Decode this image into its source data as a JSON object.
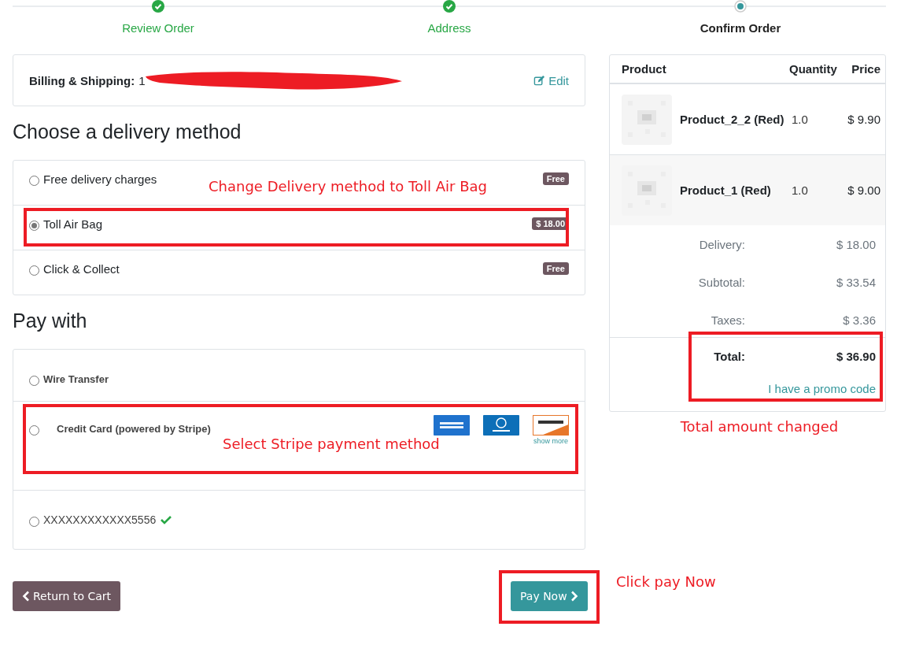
{
  "steps": [
    {
      "label": "Review Order",
      "done": true,
      "selected": false
    },
    {
      "label": "Address",
      "done": true,
      "selected": false
    },
    {
      "label": "Confirm Order",
      "done": false,
      "selected": true
    }
  ],
  "billing": {
    "label": "Billing & Shipping:",
    "value": "1",
    "redacted": true,
    "edit": "Edit"
  },
  "delivery": {
    "heading": "Choose a delivery method",
    "note": "Change Delivery method to Toll Air Bag",
    "methods": [
      {
        "label": "Free delivery charges",
        "price": "Free",
        "selected": false,
        "outlined": false
      },
      {
        "label": "Toll Air Bag",
        "price": "$ 18.00",
        "selected": true,
        "outlined": true
      },
      {
        "label": "Click & Collect",
        "price": "Free",
        "selected": false,
        "outlined": false
      }
    ]
  },
  "payment": {
    "heading": "Pay with",
    "note": "Select Stripe payment method",
    "methods": [
      {
        "kind": "plain",
        "label": "Wire Transfer",
        "selected": false,
        "outlined": false
      },
      {
        "kind": "cards",
        "label": "Credit Card (powered by Stripe)",
        "selected": false,
        "outlined": true,
        "more": "show more"
      },
      {
        "kind": "saved",
        "label": "XXXXXXXXXXXX5556",
        "selected": false,
        "outlined": false,
        "verified": true
      }
    ]
  },
  "buttons": {
    "back": "Return to Cart",
    "pay": "Pay Now",
    "pay_outlined": true,
    "pay_note": "Click pay Now"
  },
  "cart": {
    "columns": [
      "Product",
      "Quantity",
      "Price"
    ],
    "rows": [
      {
        "product": "Product_2_2 (Red)",
        "quantity": "1.0",
        "price": "$ 9.90"
      },
      {
        "product": "Product_1 (Red)",
        "quantity": "1.0",
        "price": "$ 9.00"
      }
    ],
    "summary": [
      {
        "label": "Delivery:",
        "value": "$ 18.00"
      },
      {
        "label": "Subtotal:",
        "value": "$ 33.54"
      },
      {
        "label": "Taxes:",
        "value": "$ 3.36"
      }
    ],
    "total": {
      "label": "Total:",
      "value": "$ 36.90"
    },
    "promo": "I have a promo code",
    "total_outlined": true,
    "note": "Total amount changed"
  }
}
